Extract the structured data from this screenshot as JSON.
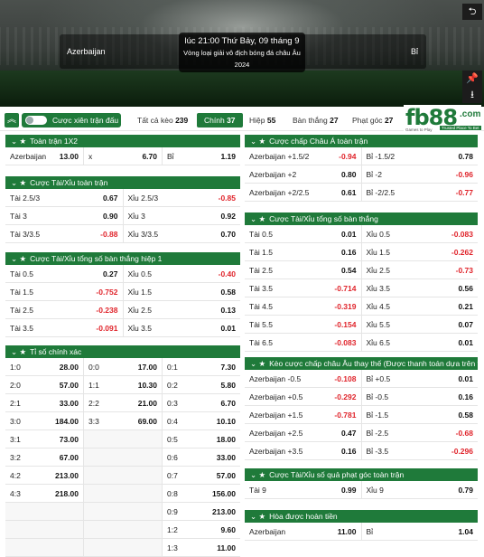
{
  "header": {
    "datetime": "lúc 21:00 Thứ Bảy, 09 tháng 9",
    "league": "Vòng loại giải vô địch bóng đá châu Âu 2024",
    "home": "Azerbaijan",
    "away": "Bỉ",
    "icons": [
      "back-icon",
      "pin-icon",
      "download-icon"
    ]
  },
  "toolbar": {
    "collapse_icon": "chevron-up-icon",
    "combo_label": "Cược xiên trận đấu",
    "tabs": [
      {
        "label": "Tất cả kèo",
        "count": "239"
      },
      {
        "label": "Chính",
        "count": "37"
      },
      {
        "label": "Hiệp",
        "count": "55"
      },
      {
        "label": "Bàn thắng",
        "count": "27"
      },
      {
        "label": "Phạt góc",
        "count": "27"
      }
    ]
  },
  "logo": {
    "text": "fb88",
    "suffix": ".com",
    "tagline": "Games to Play",
    "slogan": "Trusted Place To Bet"
  },
  "colors": {
    "primary": "#1f7a3a",
    "negative": "#e0242b"
  },
  "markets_left": [
    {
      "title": "Toàn trận 1X2",
      "cols": 3,
      "rows": [
        [
          [
            "Azerbaijan",
            "13.00"
          ],
          [
            "x",
            "6.70"
          ],
          [
            "Bỉ",
            "1.19"
          ]
        ]
      ]
    },
    {
      "title": "Cược Tài/Xỉu toàn trận",
      "cols": 2,
      "rows": [
        [
          [
            "Tài 2.5/3",
            "0.67"
          ],
          [
            "Xỉu 2.5/3",
            "-0.85"
          ]
        ],
        [
          [
            "Tài 3",
            "0.90"
          ],
          [
            "Xỉu 3",
            "0.92"
          ]
        ],
        [
          [
            "Tài 3/3.5",
            "-0.88"
          ],
          [
            "Xỉu 3/3.5",
            "0.70"
          ]
        ]
      ]
    },
    {
      "title": "Cược Tài/Xỉu tổng số bàn thắng hiệp 1",
      "cols": 2,
      "rows": [
        [
          [
            "Tài 0.5",
            "0.27"
          ],
          [
            "Xỉu 0.5",
            "-0.40"
          ]
        ],
        [
          [
            "Tài 1.5",
            "-0.752"
          ],
          [
            "Xỉu 1.5",
            "0.58"
          ]
        ],
        [
          [
            "Tài 2.5",
            "-0.238"
          ],
          [
            "Xỉu 2.5",
            "0.13"
          ]
        ],
        [
          [
            "Tài 3.5",
            "-0.091"
          ],
          [
            "Xỉu 3.5",
            "0.01"
          ]
        ]
      ]
    },
    {
      "title": "Tỉ số chính xác",
      "cols": 3,
      "rows": [
        [
          [
            "1:0",
            "28.00"
          ],
          [
            "0:0",
            "17.00"
          ],
          [
            "0:1",
            "7.30"
          ]
        ],
        [
          [
            "2:0",
            "57.00"
          ],
          [
            "1:1",
            "10.30"
          ],
          [
            "0:2",
            "5.80"
          ]
        ],
        [
          [
            "2:1",
            "33.00"
          ],
          [
            "2:2",
            "21.00"
          ],
          [
            "0:3",
            "6.70"
          ]
        ],
        [
          [
            "3:0",
            "184.00"
          ],
          [
            "3:3",
            "69.00"
          ],
          [
            "0:4",
            "10.10"
          ]
        ],
        [
          [
            "3:1",
            "73.00"
          ],
          null,
          [
            "0:5",
            "18.00"
          ]
        ],
        [
          [
            "3:2",
            "67.00"
          ],
          null,
          [
            "0:6",
            "33.00"
          ]
        ],
        [
          [
            "4:2",
            "213.00"
          ],
          null,
          [
            "0:7",
            "57.00"
          ]
        ],
        [
          [
            "4:3",
            "218.00"
          ],
          null,
          [
            "0:8",
            "156.00"
          ]
        ],
        [
          null,
          null,
          [
            "0:9",
            "213.00"
          ]
        ],
        [
          null,
          null,
          [
            "1:2",
            "9.60"
          ]
        ],
        [
          null,
          null,
          [
            "1:3",
            "11.00"
          ]
        ]
      ]
    }
  ],
  "markets_right": [
    {
      "title": "Cược chấp Châu Á toàn trận",
      "cols": 2,
      "rows": [
        [
          [
            "Azerbaijan +1.5/2",
            "-0.94"
          ],
          [
            "Bỉ -1.5/2",
            "0.78"
          ]
        ],
        [
          [
            "Azerbaijan +2",
            "0.80"
          ],
          [
            "Bỉ -2",
            "-0.96"
          ]
        ],
        [
          [
            "Azerbaijan +2/2.5",
            "0.61"
          ],
          [
            "Bỉ -2/2.5",
            "-0.77"
          ]
        ]
      ]
    },
    {
      "title": "Cược Tài/Xỉu tổng số bàn thắng",
      "cols": 2,
      "rows": [
        [
          [
            "Tài 0.5",
            "0.01"
          ],
          [
            "Xỉu 0.5",
            "-0.083"
          ]
        ],
        [
          [
            "Tài 1.5",
            "0.16"
          ],
          [
            "Xỉu 1.5",
            "-0.262"
          ]
        ],
        [
          [
            "Tài 2.5",
            "0.54"
          ],
          [
            "Xỉu 2.5",
            "-0.73"
          ]
        ],
        [
          [
            "Tài 3.5",
            "-0.714"
          ],
          [
            "Xỉu 3.5",
            "0.56"
          ]
        ],
        [
          [
            "Tài 4.5",
            "-0.319"
          ],
          [
            "Xỉu 4.5",
            "0.21"
          ]
        ],
        [
          [
            "Tài 5.5",
            "-0.154"
          ],
          [
            "Xỉu 5.5",
            "0.07"
          ]
        ],
        [
          [
            "Tài 6.5",
            "-0.083"
          ],
          [
            "Xỉu 6.5",
            "0.01"
          ]
        ]
      ]
    },
    {
      "title": "Kèo cược chấp châu Âu thay thế (Được thanh toán dựa trên tỷ...",
      "cols": 2,
      "rows": [
        [
          [
            "Azerbaijan -0.5",
            "-0.108"
          ],
          [
            "Bỉ +0.5",
            "0.01"
          ]
        ],
        [
          [
            "Azerbaijan +0.5",
            "-0.292"
          ],
          [
            "Bỉ -0.5",
            "0.16"
          ]
        ],
        [
          [
            "Azerbaijan +1.5",
            "-0.781"
          ],
          [
            "Bỉ -1.5",
            "0.58"
          ]
        ],
        [
          [
            "Azerbaijan +2.5",
            "0.47"
          ],
          [
            "Bỉ -2.5",
            "-0.68"
          ]
        ],
        [
          [
            "Azerbaijan +3.5",
            "0.16"
          ],
          [
            "Bỉ -3.5",
            "-0.296"
          ]
        ]
      ]
    },
    {
      "title": "Cược Tài/Xỉu số quả phạt góc toàn trận",
      "cols": 2,
      "rows": [
        [
          [
            "Tài 9",
            "0.99"
          ],
          [
            "Xỉu 9",
            "0.79"
          ]
        ]
      ]
    },
    {
      "title": "Hòa được hoàn tiền",
      "cols": 2,
      "rows": [
        [
          [
            "Azerbaijan",
            "11.00"
          ],
          [
            "Bỉ",
            "1.04"
          ]
        ]
      ]
    }
  ]
}
